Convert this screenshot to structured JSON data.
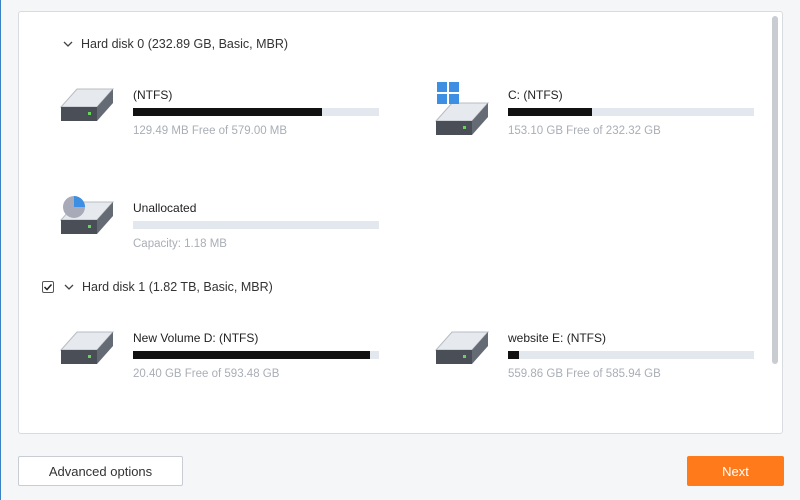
{
  "disks": [
    {
      "header": "Hard disk 0 (232.89 GB, Basic, MBR)",
      "checked": false,
      "partitions": [
        {
          "name": " (NTFS)",
          "info": "129.49 MB Free of 579.00 MB",
          "used_fraction": 0.77,
          "icon": "hard-drive-icon"
        },
        {
          "name": "C: (NTFS)",
          "info": "153.10 GB Free of 232.32 GB",
          "used_fraction": 0.34,
          "icon": "windows-drive-icon"
        },
        {
          "name": "Unallocated",
          "info": "Capacity: 1.18 MB",
          "used_fraction": 0.0,
          "icon": "unallocated-drive-icon"
        }
      ]
    },
    {
      "header": "Hard disk 1 (1.82 TB, Basic, MBR)",
      "checked": true,
      "partitions": [
        {
          "name": "New Volume D: (NTFS)",
          "info": "20.40 GB Free of 593.48 GB",
          "used_fraction": 0.965,
          "icon": "hard-drive-icon"
        },
        {
          "name": "website E: (NTFS)",
          "info": "559.86 GB Free of 585.94 GB",
          "used_fraction": 0.045,
          "icon": "hard-drive-icon"
        }
      ]
    }
  ],
  "footer": {
    "advanced_label": "Advanced options",
    "next_label": "Next"
  },
  "colors": {
    "accent": "#ff7a1a",
    "bar_fill": "#111111",
    "bar_track": "#e3e7ee",
    "windows_blue": "#3d8fe3",
    "pie_blue": "#3d8fe3"
  }
}
